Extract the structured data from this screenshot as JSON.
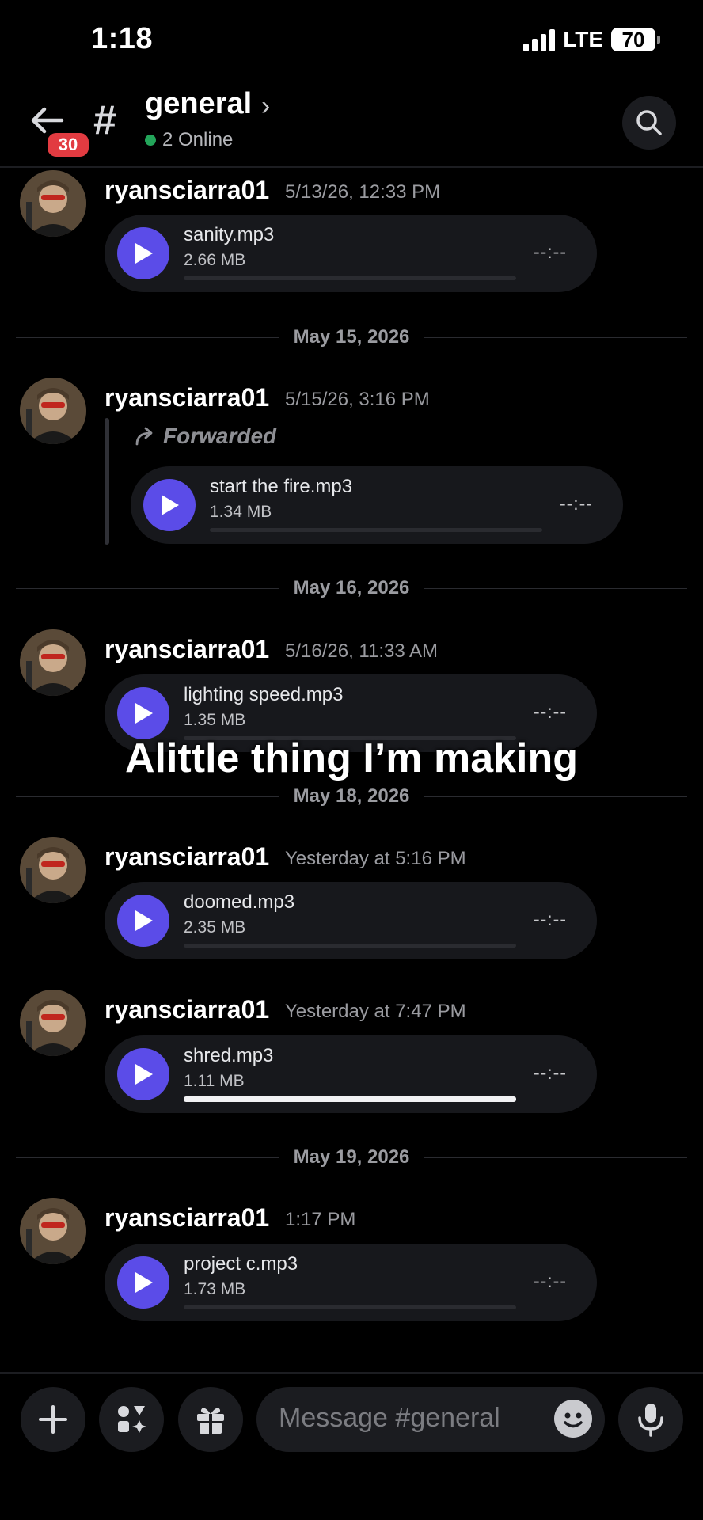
{
  "status": {
    "time": "1:18",
    "network": "LTE",
    "battery": "70"
  },
  "header": {
    "back_badge": "30",
    "channel_name": "general",
    "online": "2 Online"
  },
  "messages": [
    {
      "author": "ryansciarra01",
      "timestamp": "5/13/26, 12:33 PM",
      "file": "sanity.mp3",
      "size": "2.66 MB",
      "duration": "--:--"
    },
    {
      "author": "ryansciarra01",
      "timestamp": "5/15/26, 3:16 PM",
      "forwarded_label": "Forwarded",
      "file": "start the fire.mp3",
      "size": "1.34 MB",
      "duration": "--:--"
    },
    {
      "author": "ryansciarra01",
      "timestamp": "5/16/26, 11:33 AM",
      "file": "lighting speed.mp3",
      "size": "1.35 MB",
      "duration": "--:--"
    },
    {
      "author": "ryansciarra01",
      "timestamp": "Yesterday at 5:16 PM",
      "file": "doomed.mp3",
      "size": "2.35 MB",
      "duration": "--:--"
    },
    {
      "author": "ryansciarra01",
      "timestamp": "Yesterday at 7:47 PM",
      "file": "shred.mp3",
      "size": "1.11 MB",
      "duration": "--:--",
      "progress": 1.0
    },
    {
      "author": "ryansciarra01",
      "timestamp": "1:17 PM",
      "file": "project c.mp3",
      "size": "1.73 MB",
      "duration": "--:--"
    }
  ],
  "dividers": [
    "May 15, 2026",
    "May 16, 2026",
    "May 18, 2026",
    "May 19, 2026"
  ],
  "overlay_caption": "Alittle thing I’m making",
  "composer": {
    "placeholder": "Message #general"
  },
  "colors": {
    "play_button": "#5b4ce8",
    "online_dot": "#23a55a",
    "badge": "#e23b41"
  }
}
